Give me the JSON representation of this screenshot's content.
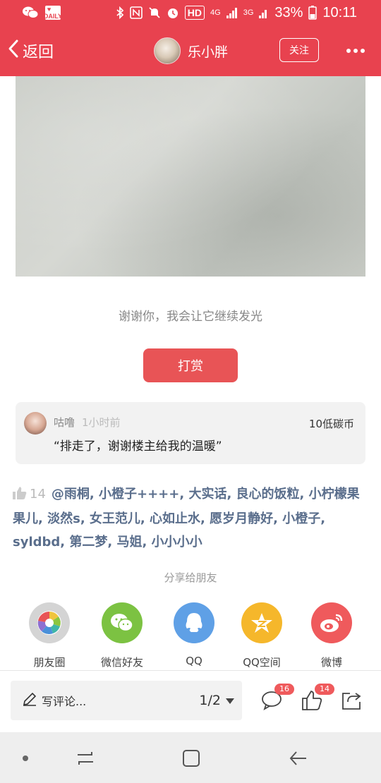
{
  "status_bar": {
    "app_badge_text": "I ♥ DAILY",
    "hd": "HD",
    "net_4g": "4G",
    "net_3g": "3G",
    "battery": "33%",
    "time": "10:11"
  },
  "header": {
    "back_label": "返回",
    "username": "乐小胖",
    "follow_label": "关注"
  },
  "post": {
    "thanks_text": "谢谢你，我会让它继续发光",
    "reward_label": "打赏"
  },
  "reward_comment": {
    "name": "咕噜",
    "time": "1小时前",
    "amount": "10低碳币",
    "text": "“排走了，谢谢楼主给我的温暖”"
  },
  "likes": {
    "count": "14",
    "users": "@雨桐, 小橙子++++, 大实话, 良心的饭粒, 小柠檬果果儿, 淡然s, 女王范儿, 心如止水, 愿岁月静好, 小橙子, syldbd, 第二梦, 马姐, 小小小小"
  },
  "share": {
    "title": "分享给朋友",
    "items": [
      {
        "label": "朋友圈",
        "icon": "moments-icon",
        "color": "#c9c9c9"
      },
      {
        "label": "微信好友",
        "icon": "wechat-icon",
        "color": "#7cc242"
      },
      {
        "label": "QQ",
        "icon": "qq-icon",
        "color": "#5fa0e6"
      },
      {
        "label": "QQ空间",
        "icon": "qzone-icon",
        "color": "#f5b72b"
      },
      {
        "label": "微博",
        "icon": "weibo-icon",
        "color": "#ef5a5c"
      }
    ]
  },
  "bottom": {
    "comment_placeholder": "写评论...",
    "page_indicator": "1/2",
    "comment_count": "16",
    "like_count": "14"
  },
  "colors": {
    "brand": "#e8424f",
    "link": "#5a6e8c"
  }
}
